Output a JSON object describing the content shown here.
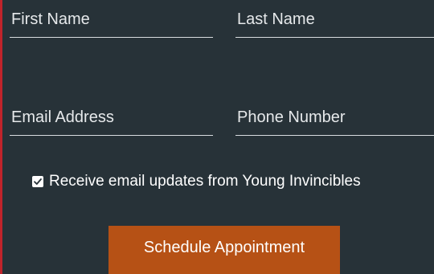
{
  "form": {
    "first_name": {
      "placeholder": "First Name",
      "value": ""
    },
    "last_name": {
      "placeholder": "Last Name",
      "value": ""
    },
    "email": {
      "placeholder": "Email Address",
      "value": ""
    },
    "phone": {
      "placeholder": "Phone Number",
      "value": ""
    },
    "updates_checkbox": {
      "label": "Receive email updates from Young Invincibles",
      "checked": true
    },
    "submit_label": "Schedule Appointment"
  },
  "colors": {
    "background": "#273238",
    "accent_border": "#c0242b",
    "button": "#b65115",
    "field_underline": "#d8dcdf"
  },
  "icons": {
    "checkbox": "checkmark-icon"
  }
}
